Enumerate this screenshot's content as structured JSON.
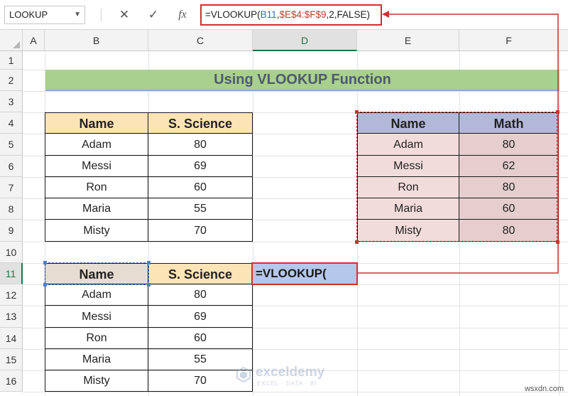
{
  "formula_bar": {
    "name_box": "LOOKUP",
    "formula_prefix": "=VLOOKUP(",
    "formula_ref1": "B11",
    "formula_comma1": ",",
    "formula_ref2": "$E$4:$F$9",
    "formula_suffix": ",2,FALSE)",
    "cancel_glyph": "✕",
    "enter_glyph": "✓",
    "fx_glyph": "fx"
  },
  "columns": [
    "A",
    "B",
    "C",
    "D",
    "E",
    "F"
  ],
  "rows": [
    "1",
    "2",
    "3",
    "4",
    "5",
    "6",
    "7",
    "8",
    "9",
    "10",
    "11",
    "12",
    "13",
    "14",
    "15",
    "16"
  ],
  "title": "Using VLOOKUP Function",
  "table1": {
    "headers": [
      "Name",
      "S. Science"
    ],
    "rows": [
      [
        "Adam",
        "80"
      ],
      [
        "Messi",
        "69"
      ],
      [
        "Ron",
        "60"
      ],
      [
        "Maria",
        "55"
      ],
      [
        "Misty",
        "70"
      ]
    ]
  },
  "table2": {
    "headers": [
      "Name",
      "Math"
    ],
    "rows": [
      [
        "Adam",
        "80"
      ],
      [
        "Messi",
        "62"
      ],
      [
        "Ron",
        "80"
      ],
      [
        "Maria",
        "60"
      ],
      [
        "Misty",
        "80"
      ]
    ]
  },
  "table3": {
    "headers": [
      "Name",
      "S. Science"
    ],
    "rows": [
      [
        "Adam",
        "80"
      ],
      [
        "Messi",
        "69"
      ],
      [
        "Ron",
        "60"
      ],
      [
        "Maria",
        "55"
      ],
      [
        "Misty",
        "70"
      ]
    ]
  },
  "active_cell_text": "=VLOOKUP(",
  "watermark": {
    "name": "exceldemy",
    "tagline": "EXCEL · DATA · BI"
  },
  "source_label": "wsxdn.com",
  "colors": {
    "accent_red": "#d32f2f",
    "excel_green": "#217346",
    "ref_blue": "#2f6fd0"
  }
}
